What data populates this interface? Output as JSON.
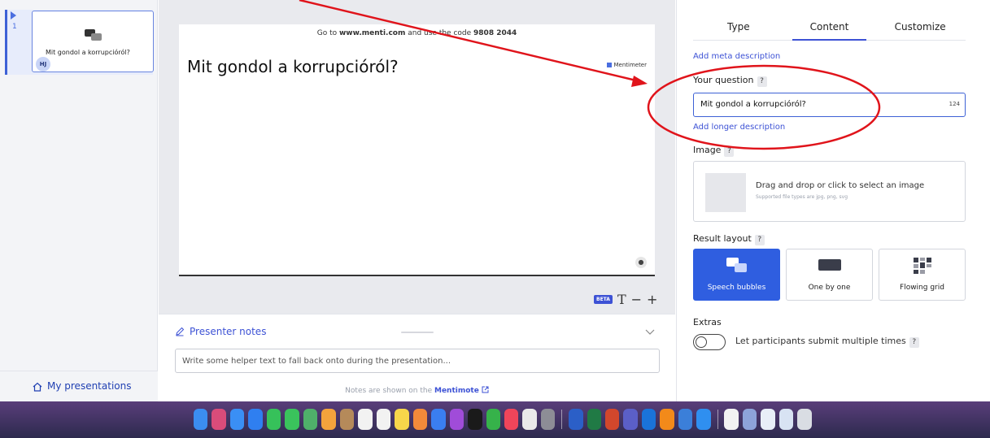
{
  "sidebar": {
    "slides": [
      {
        "number": "1",
        "title": "Mit gondol a korrupcióról?",
        "avatar": "HJ"
      }
    ],
    "my_presentations": "My presentations"
  },
  "slide": {
    "join_prefix": "Go to ",
    "join_url": "www.menti.com",
    "join_middle": " and use the code ",
    "join_code": "9808 2044",
    "title": "Mit gondol a korrupcióról?",
    "brand": "Mentimeter"
  },
  "toolbar": {
    "beta": "BETA",
    "text_size": "T",
    "minus": "−",
    "plus": "+"
  },
  "notes": {
    "title": "Presenter notes",
    "placeholder": "Write some helper text to fall back onto during the presentation...",
    "footer_prefix": "Notes are shown on the ",
    "footer_link": "Mentimote"
  },
  "panel": {
    "tabs": [
      {
        "label": "Type",
        "active": false
      },
      {
        "label": "Content",
        "active": true
      },
      {
        "label": "Customize",
        "active": false
      }
    ],
    "add_meta": "Add meta description",
    "question_label": "Your question",
    "help": "?",
    "question_value": "Mit gondol a korrupcióról?",
    "char_count": "124",
    "add_longer": "Add longer description",
    "image_label": "Image",
    "drop_text": "Drag and drop or click to select an image",
    "drop_sub": "Supported file types are jpg, png, svg",
    "result_layout_label": "Result layout",
    "layouts": [
      {
        "label": "Speech bubbles",
        "active": true
      },
      {
        "label": "One by one",
        "active": false
      },
      {
        "label": "Flowing grid",
        "active": false
      }
    ],
    "extras_label": "Extras",
    "multiple_label": "Let participants submit multiple times"
  },
  "colors": {
    "accent": "#3d52d5",
    "annotation": "#e0141b"
  },
  "dock": {
    "apps": [
      {
        "name": "finder",
        "color": "#3b8df0"
      },
      {
        "name": "launchpad",
        "color": "#d94c7a"
      },
      {
        "name": "mail",
        "color": "#3a8ff5"
      },
      {
        "name": "app-store",
        "color": "#2f7ff0"
      },
      {
        "name": "facetime",
        "color": "#36c15a"
      },
      {
        "name": "messages",
        "color": "#3ac35c"
      },
      {
        "name": "maps",
        "color": "#4fb06a"
      },
      {
        "name": "photos",
        "color": "#f3a33c"
      },
      {
        "name": "contacts",
        "color": "#b58a5a"
      },
      {
        "name": "calendar",
        "color": "#f2f2f2"
      },
      {
        "name": "reminders",
        "color": "#f2f2f2"
      },
      {
        "name": "notes",
        "color": "#f7d64a"
      },
      {
        "name": "freeform",
        "color": "#f28a3a"
      },
      {
        "name": "keynote",
        "color": "#3a7ef0"
      },
      {
        "name": "podcasts",
        "color": "#a04cd9"
      },
      {
        "name": "tv",
        "color": "#1a1a1a"
      },
      {
        "name": "numbers",
        "color": "#36b24a"
      },
      {
        "name": "music",
        "color": "#f0455a"
      },
      {
        "name": "chrome",
        "color": "#e9e9e9"
      },
      {
        "name": "settings",
        "color": "#8d8d96"
      },
      {
        "name": "word",
        "color": "#2b5fc7"
      },
      {
        "name": "excel",
        "color": "#207a45"
      },
      {
        "name": "powerpoint",
        "color": "#d2472c"
      },
      {
        "name": "teams",
        "color": "#5b5fc7"
      },
      {
        "name": "outlook",
        "color": "#1a73d9"
      },
      {
        "name": "infuse",
        "color": "#f28a1a"
      },
      {
        "name": "remote-desktop",
        "color": "#3b7fd9"
      },
      {
        "name": "safari",
        "color": "#2f8ff0"
      },
      {
        "name": "document",
        "color": "#f2f2f2"
      },
      {
        "name": "help",
        "color": "#8da3d9"
      },
      {
        "name": "screen",
        "color": "#e8eef8"
      },
      {
        "name": "screen-2",
        "color": "#d8e3f3"
      },
      {
        "name": "trash",
        "color": "#d9dde3"
      }
    ]
  }
}
